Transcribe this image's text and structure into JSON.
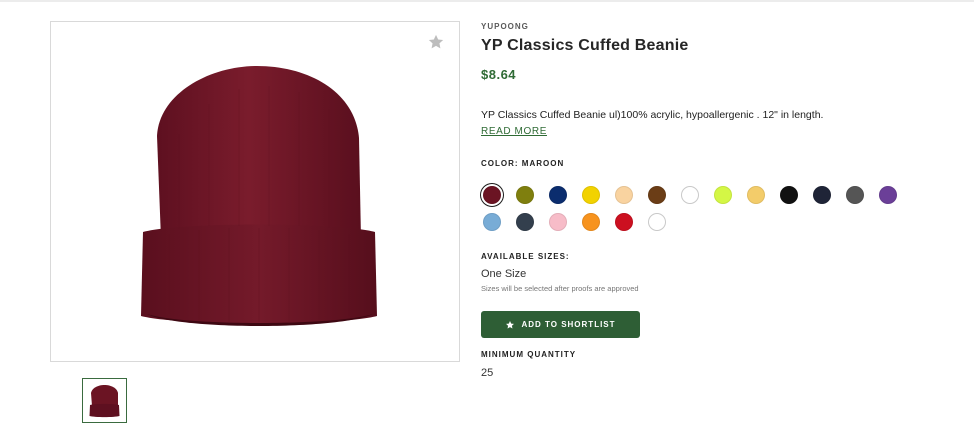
{
  "product": {
    "brand": "YUPOONG",
    "title": "YP Classics Cuffed Beanie",
    "price": "$8.64",
    "description": "YP Classics Cuffed Beanie ul)100% acrylic, hypoallergenic . 12\" in length.",
    "read_more": "READ MORE",
    "color_label": "COLOR:",
    "color_value": "MAROON",
    "sizes_label": "AVAILABLE SIZES:",
    "size_value": "One Size",
    "size_note": "Sizes will be selected after proofs are approved",
    "shortlist_label": "ADD TO SHORTLIST",
    "min_qty_label": "MINIMUM QUANTITY",
    "min_qty_value": "25"
  },
  "gallery": {
    "favorite_icon": "star-icon",
    "thumbnail_count": 1,
    "image_color": "#6b1423"
  },
  "swatches": [
    {
      "color": "#6b1423",
      "selected": true
    },
    {
      "color": "#7f7f0e"
    },
    {
      "color": "#0b2d6e"
    },
    {
      "color": "#f2d200"
    },
    {
      "color": "#f9d3a0"
    },
    {
      "color": "#6b3d16"
    },
    {
      "color": "#ffffff"
    },
    {
      "color": "#d4f745"
    },
    {
      "color": "#f3cc6a"
    },
    {
      "color": "#111111"
    },
    {
      "color": "#1f2437"
    },
    {
      "color": "#555555"
    },
    {
      "color": "#6b3f98"
    },
    {
      "color": "#78acd6"
    },
    {
      "color": "#333f4d"
    },
    {
      "color": "#f7bcc8"
    },
    {
      "color": "#f7931e"
    },
    {
      "color": "#cc1020"
    },
    {
      "color": "#ffffff"
    }
  ],
  "theme": {
    "accent": "#2e5e35",
    "price_color": "#2f6b35"
  }
}
